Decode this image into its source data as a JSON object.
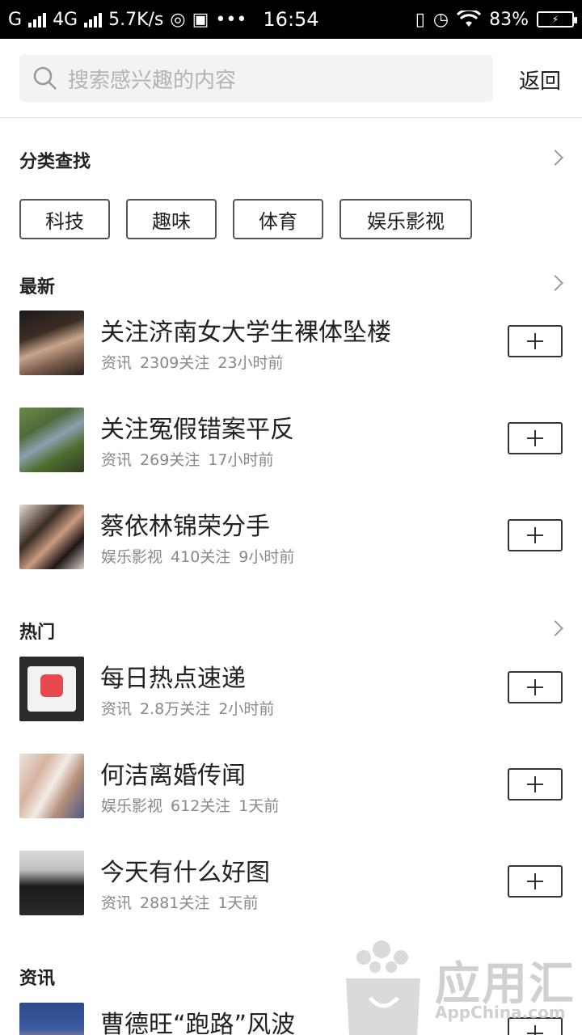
{
  "status": {
    "carrier1": "G",
    "carrier2": "4G",
    "speed": "5.7K/s",
    "dots": "•••",
    "time": "16:54",
    "battery": "83%"
  },
  "search": {
    "placeholder": "搜索感兴趣的内容",
    "back_label": "返回"
  },
  "categories": {
    "title": "分类查找",
    "tags": [
      "科技",
      "趣味",
      "体育",
      "娱乐影视"
    ]
  },
  "latest": {
    "title": "最新",
    "items": [
      {
        "title": "关注济南女大学生裸体坠楼",
        "category": "资讯",
        "follows": "2309关注",
        "time": "23小时前"
      },
      {
        "title": "关注冤假错案平反",
        "category": "资讯",
        "follows": "269关注",
        "time": "17小时前"
      },
      {
        "title": "蔡依林锦荣分手",
        "category": "娱乐影视",
        "follows": "410关注",
        "time": "9小时前"
      }
    ]
  },
  "hot": {
    "title": "热门",
    "items": [
      {
        "title": "每日热点速递",
        "category": "资讯",
        "follows": "2.8万关注",
        "time": "2小时前"
      },
      {
        "title": "何洁离婚传闻",
        "category": "娱乐影视",
        "follows": "612关注",
        "time": "1天前"
      },
      {
        "title": "今天有什么好图",
        "category": "资讯",
        "follows": "2881关注",
        "time": "1天前"
      }
    ]
  },
  "news": {
    "title": "资讯",
    "items": [
      {
        "title": "曹德旺“跑路”风波"
      }
    ]
  },
  "watermark": {
    "name": "应用汇",
    "site": "AppChina.com"
  },
  "colors": {
    "accent_text": "#222222",
    "meta_text": "#888888",
    "placeholder": "#b3b3b3"
  }
}
